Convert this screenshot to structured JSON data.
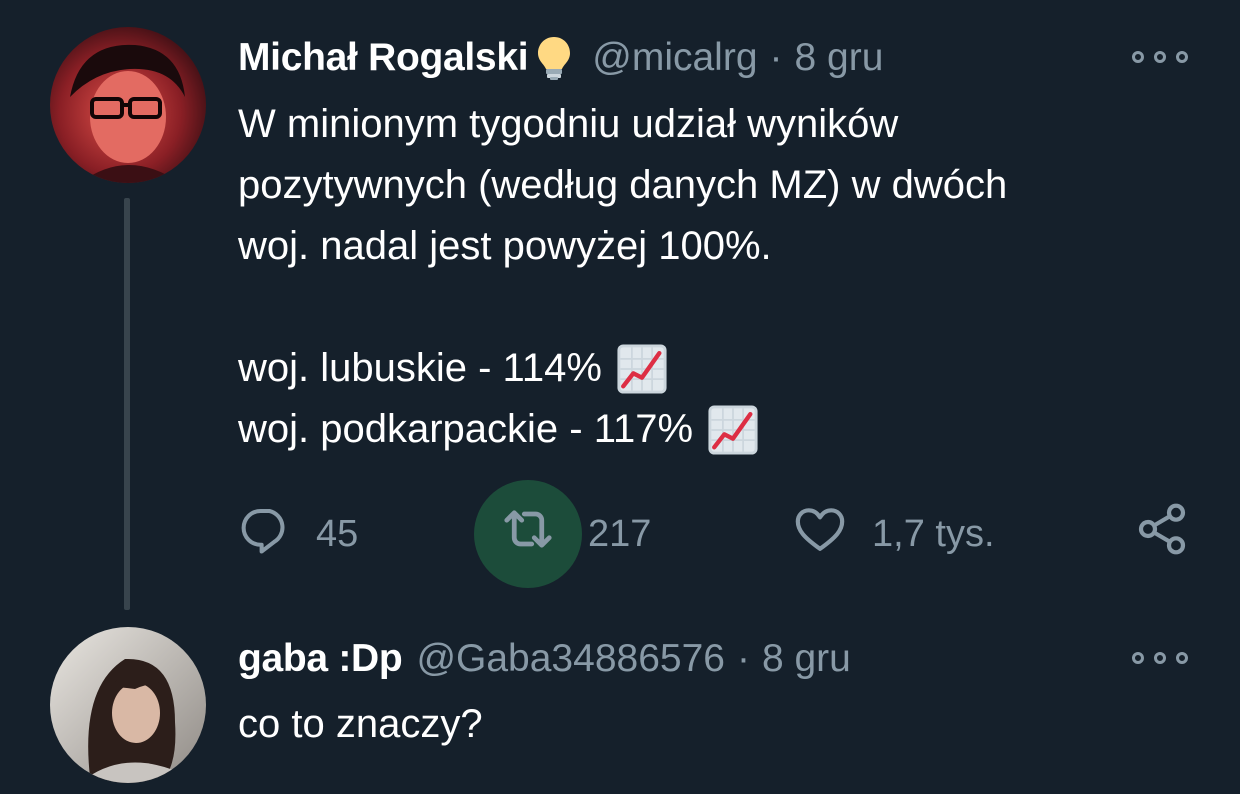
{
  "thread": [
    {
      "author": {
        "name": "Michał Rogalski",
        "badge_icon": "lightbulb-icon",
        "handle": "@micalrg",
        "date": "8 gru"
      },
      "text_lines": [
        "W minionym tygodniu udział wyników",
        "pozytywnych (według danych MZ) w dwóch",
        "woj. nadal jest powyżej 100%.",
        "",
        "woj. lubuskie - 114%",
        "woj. podkarpackie - 117%"
      ],
      "line_emoji": "chart-increasing-icon",
      "actions": {
        "replies": "45",
        "retweets": "217",
        "likes": "1,7 tys."
      },
      "retweet_active_color": "#1c4c3a"
    },
    {
      "author": {
        "name": "gaba :Dp",
        "handle": "@Gaba34886576",
        "date": "8 gru"
      },
      "text_lines": [
        "co to znaczy?"
      ]
    }
  ],
  "colors": {
    "background": "#15202b",
    "secondary_text": "#8899a6",
    "primary_text": "#ffffff",
    "thread_line": "#38444d"
  },
  "separator": "·"
}
